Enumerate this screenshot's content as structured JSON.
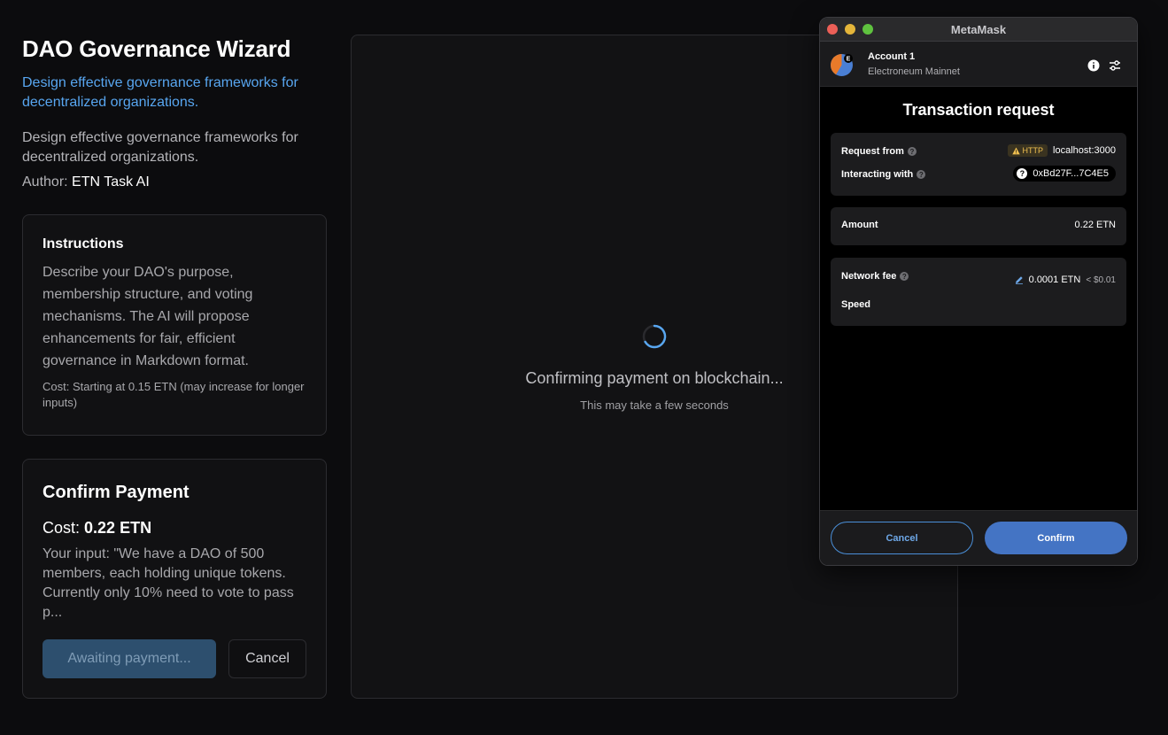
{
  "app": {
    "title": "DAO Governance Wizard",
    "subtitle": "Design effective governance frameworks for decentralized organizations.",
    "description": "Design effective governance frameworks for decentralized organizations.",
    "author_label": "Author:",
    "author_name": "ETN Task AI"
  },
  "instructions": {
    "title": "Instructions",
    "text": "Describe your DAO's purpose, membership structure, and voting mechanisms. The AI will propose enhancements for fair, efficient governance in Markdown format.",
    "cost": "Cost: Starting at 0.15 ETN (may increase for longer inputs)"
  },
  "payment": {
    "title": "Confirm Payment",
    "cost_label": "Cost:",
    "cost_value": "0.22 ETN",
    "input_preview": "Your input: \"We have a DAO of 500 members, each holding unique tokens. Currently only 10% need to vote to pass p...",
    "awaiting_label": "Awaiting payment...",
    "cancel_label": "Cancel"
  },
  "status": {
    "message": "Confirming payment on blockchain...",
    "sub": "This may take a few seconds"
  },
  "metamask": {
    "window_title": "MetaMask",
    "account_name": "Account 1",
    "network": "Electroneum Mainnet",
    "avatar_letter": "E",
    "heading": "Transaction request",
    "request_from_label": "Request from",
    "http_badge": "HTTP",
    "request_from_value": "localhost:3000",
    "interacting_label": "Interacting with",
    "interacting_value": "0xBd27F...7C4E5",
    "amount_label": "Amount",
    "amount_value": "0.22 ETN",
    "fee_label": "Network fee",
    "fee_value": "0.0001 ETN",
    "fee_usd": "< $0.01",
    "speed_label": "Speed",
    "cancel_label": "Cancel",
    "confirm_label": "Confirm"
  },
  "colors": {
    "accent_blue": "#58a6f0",
    "metamask_confirm": "#4474c4",
    "warning": "#f0c050"
  }
}
